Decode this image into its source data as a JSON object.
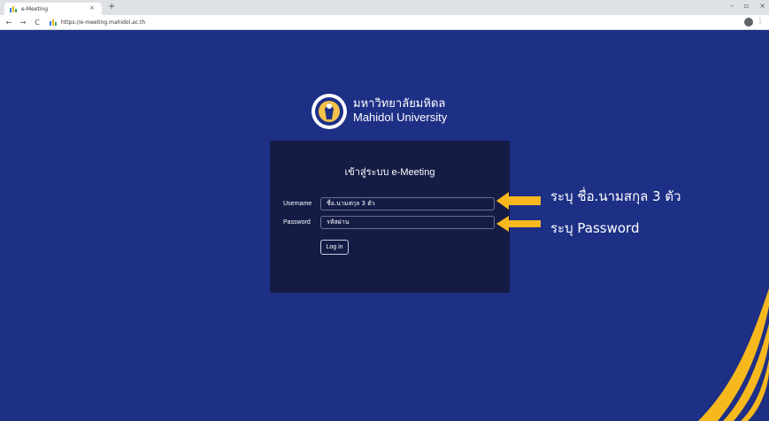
{
  "browser": {
    "tab_title": "e-Meeting",
    "tab_close": "×",
    "new_tab": "+",
    "url": "https://e-meeting.mahidol.ac.th",
    "nav_back": "←",
    "nav_forward": "→",
    "nav_reload": "C",
    "win_minimize": "–",
    "win_restore": "▫",
    "win_close": "×",
    "menu": "⋮"
  },
  "logo": {
    "thai": "มหาวิทยาลัยมหิดล",
    "english": "Mahidol University"
  },
  "login": {
    "title": "เข้าสู่ระบบ e-Meeting",
    "username_label": "Username",
    "username_value": "ชื่อ.นามสกุล 3 ตัว",
    "password_label": "Password",
    "password_value": "รหัสผ่าน",
    "button": "Log in"
  },
  "annotations": {
    "username_note": "ระบุ ชื่อ.นามสกุล 3 ตัว",
    "password_note": "ระบุ Password",
    "arrow_color": "#f6b81d"
  },
  "colors": {
    "page_bg": "#1e2f86",
    "panel_bg": "#141c46",
    "accent": "#f6b81d"
  }
}
